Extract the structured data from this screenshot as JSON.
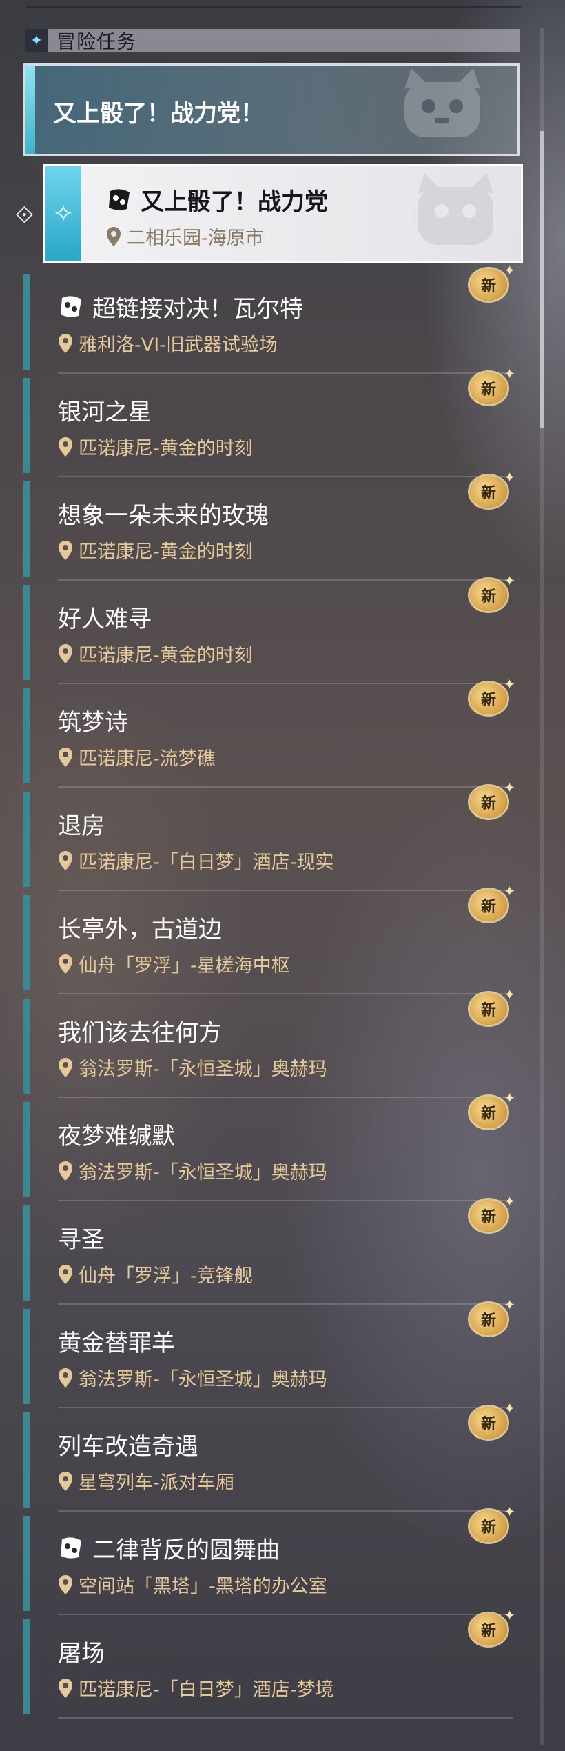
{
  "header": {
    "title": "冒险任务",
    "icon": "sparkle-icon"
  },
  "selected_group": {
    "title": "又上骰了！战力党！"
  },
  "selected_task": {
    "title": "又上骰了！战力党",
    "location": "二相乐园-海原市",
    "icon": "dice-icon"
  },
  "badge_label": "新",
  "tasks": [
    {
      "title": "超链接对决！瓦尔特",
      "location": "雅利洛-VI-旧武器试验场",
      "has_dice": true
    },
    {
      "title": "银河之星",
      "location": "匹诺康尼-黄金的时刻",
      "has_dice": false
    },
    {
      "title": "想象一朵未来的玫瑰",
      "location": "匹诺康尼-黄金的时刻",
      "has_dice": false
    },
    {
      "title": "好人难寻",
      "location": "匹诺康尼-黄金的时刻",
      "has_dice": false
    },
    {
      "title": "筑梦诗",
      "location": "匹诺康尼-流梦礁",
      "has_dice": false
    },
    {
      "title": "退房",
      "location": "匹诺康尼-「白日梦」酒店-现实",
      "has_dice": false
    },
    {
      "title": "长亭外，古道边",
      "location": "仙舟「罗浮」-星槎海中枢",
      "has_dice": false
    },
    {
      "title": "我们该去往何方",
      "location": "翁法罗斯-「永恒圣城」奥赫玛",
      "has_dice": false
    },
    {
      "title": "夜梦难缄默",
      "location": "翁法罗斯-「永恒圣城」奥赫玛",
      "has_dice": false
    },
    {
      "title": "寻圣",
      "location": "仙舟「罗浮」-竞锋舰",
      "has_dice": false
    },
    {
      "title": "黄金替罪羊",
      "location": "翁法罗斯-「永恒圣城」奥赫玛",
      "has_dice": false
    },
    {
      "title": "列车改造奇遇",
      "location": "星穹列车-派对车厢",
      "has_dice": false
    },
    {
      "title": "二律背反的圆舞曲",
      "location": "空间站「黑塔」-黑塔的办公室",
      "has_dice": true
    },
    {
      "title": "屠场",
      "location": "匹诺康尼-「白日梦」酒店-梦境",
      "has_dice": false
    }
  ],
  "colors": {
    "accent": "#3b8893",
    "location_text": "#e4c89a",
    "badge": "#d6a048"
  }
}
